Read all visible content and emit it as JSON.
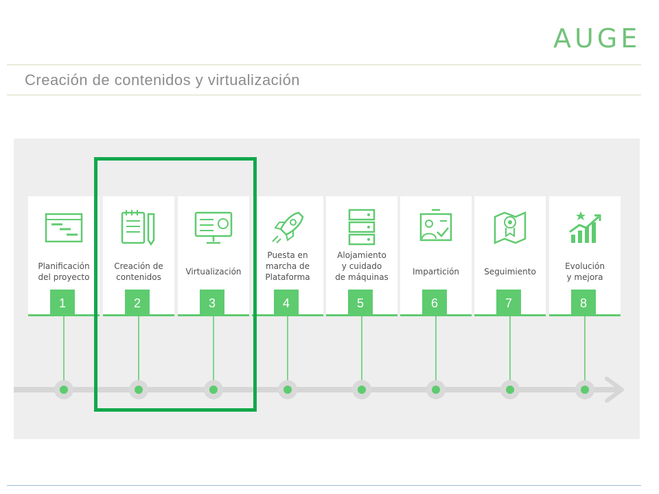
{
  "brand": {
    "logo_text": "AUGE",
    "accent_color": "#5ecb6f",
    "highlight_color": "#12a84a"
  },
  "page": {
    "title": "Creación de contenidos y virtualización"
  },
  "steps": [
    {
      "number": "1",
      "label_lines": [
        "Planificación",
        "del proyecto"
      ],
      "icon": "gantt-chart-icon"
    },
    {
      "number": "2",
      "label_lines": [
        "Creación de",
        "contenidos"
      ],
      "icon": "notepad-pen-icon"
    },
    {
      "number": "3",
      "label_lines": [
        "Virtualización"
      ],
      "icon": "monitor-icon"
    },
    {
      "number": "4",
      "label_lines": [
        "Puesta en",
        "marcha de",
        "Plataforma"
      ],
      "icon": "rocket-icon"
    },
    {
      "number": "5",
      "label_lines": [
        "Alojamiento",
        "y cuidado",
        "de máquinas"
      ],
      "icon": "server-rack-icon"
    },
    {
      "number": "6",
      "label_lines": [
        "Impartición"
      ],
      "icon": "teacher-board-icon"
    },
    {
      "number": "7",
      "label_lines": [
        "Seguimiento"
      ],
      "icon": "eye-map-icon"
    },
    {
      "number": "8",
      "label_lines": [
        "Evolución",
        "y mejora"
      ],
      "icon": "growth-chart-icon"
    }
  ],
  "highlighted_steps": [
    "2",
    "3"
  ]
}
